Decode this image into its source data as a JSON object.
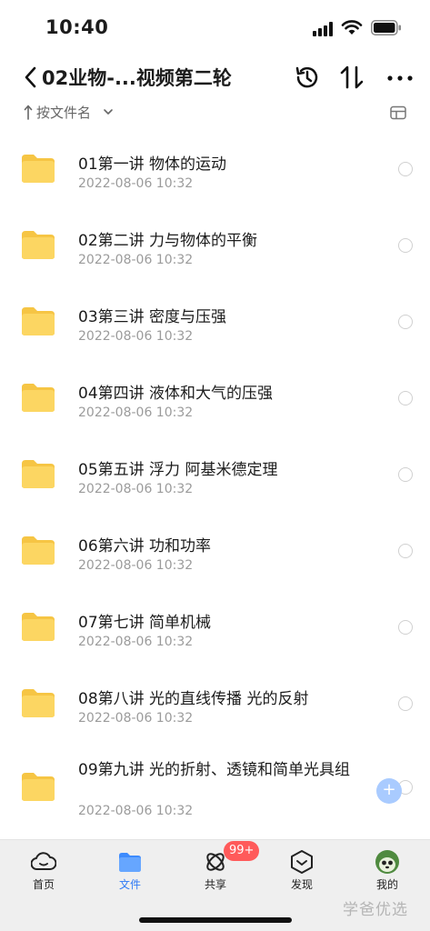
{
  "status_bar": {
    "time": "10:40"
  },
  "nav": {
    "title": "02业物-...视频第二轮"
  },
  "sort": {
    "label": "按文件名"
  },
  "files": [
    {
      "name": "01第一讲 物体的运动",
      "date": "2022-08-06 10:32"
    },
    {
      "name": "02第二讲 力与物体的平衡",
      "date": "2022-08-06 10:32"
    },
    {
      "name": "03第三讲 密度与压强",
      "date": "2022-08-06 10:32"
    },
    {
      "name": "04第四讲 液体和大气的压强",
      "date": "2022-08-06 10:32"
    },
    {
      "name": "05第五讲 浮力 阿基米德定理",
      "date": "2022-08-06 10:32"
    },
    {
      "name": "06第六讲 功和功率",
      "date": "2022-08-06 10:32"
    },
    {
      "name": "07第七讲 简单机械",
      "date": "2022-08-06 10:32"
    },
    {
      "name": "08第八讲 光的直线传播 光的反射",
      "date": "2022-08-06 10:32"
    },
    {
      "name": "09第九讲 光的折射、透镜和简单光具组",
      "date": "2022-08-06 10:32"
    }
  ],
  "fab": {
    "label": "+"
  },
  "tabs": [
    {
      "label": "首页",
      "icon": "cloud-icon"
    },
    {
      "label": "文件",
      "icon": "folder-icon"
    },
    {
      "label": "共享",
      "icon": "share-icon"
    },
    {
      "label": "发现",
      "icon": "discover-icon"
    },
    {
      "label": "我的",
      "icon": "avatar-icon"
    }
  ],
  "badge": {
    "count": "99+"
  },
  "watermark": "学爸优选",
  "colors": {
    "accent": "#2f7bf5",
    "folder": "#fcd34d",
    "badge": "#ff5a5a"
  }
}
